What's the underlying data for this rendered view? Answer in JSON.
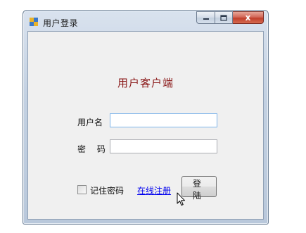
{
  "window": {
    "title": "用户登录",
    "icon": "app-icon",
    "caption_buttons": {
      "minimize": "minimize-icon",
      "maximize": "maximize-icon",
      "close": "x"
    }
  },
  "form": {
    "heading": "用户客户端",
    "username_label": "用户名",
    "username_value": "",
    "password_label": "密 码",
    "password_value": "",
    "remember_label": "记住密码",
    "remember_checked": false,
    "register_link": "在线注册",
    "login_button": "登 陆"
  },
  "colors": {
    "heading": "#8b1a1a",
    "link": "#0000ee",
    "close_button": "#c13f2c"
  }
}
